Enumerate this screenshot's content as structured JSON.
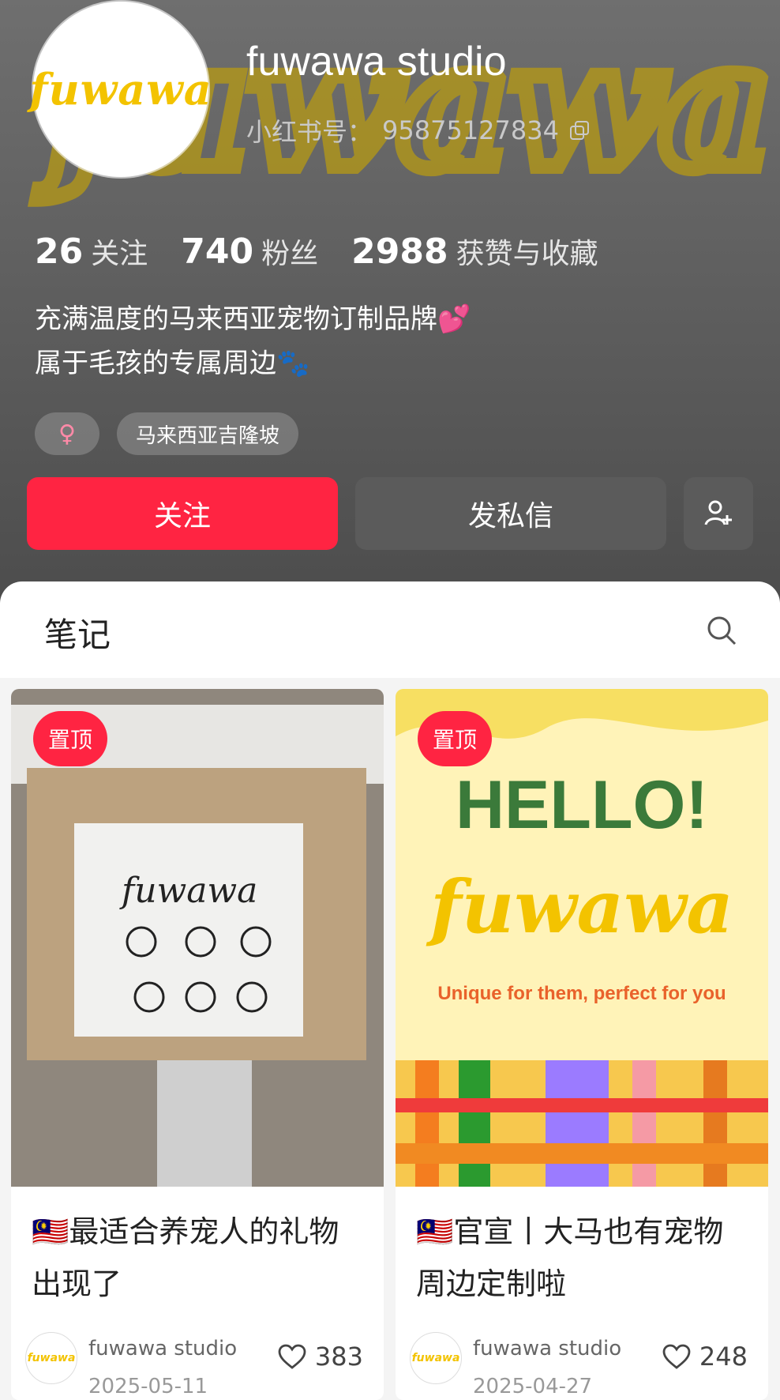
{
  "profile": {
    "name": "fuwawa studio",
    "redbook_label": "小红书号：",
    "redbook_id": "95875127834",
    "stats": [
      {
        "num": "26",
        "label": "关注"
      },
      {
        "num": "740",
        "label": "粉丝"
      },
      {
        "num": "2988",
        "label": "获赞与收藏"
      }
    ],
    "bio_line1": "充满温度的马来西亚宠物订制品牌💕",
    "bio_line2": "属于毛孩的专属周边🐾",
    "tags": {
      "gender": "♀",
      "location": "马来西亚吉隆坡"
    },
    "actions": {
      "follow": "关注",
      "message": "发私信"
    }
  },
  "notes": {
    "title": "笔记",
    "cards": [
      {
        "pin": "置顶",
        "title": "🇲🇾最适合养宠人的礼物出现了",
        "author": "fuwawa studio",
        "date": "2025-05-11",
        "likes": "383"
      },
      {
        "pin": "置顶",
        "title": "🇲🇾官宣丨大马也有宠物周边定制啦",
        "author": "fuwawa studio",
        "date": "2025-04-27",
        "likes": "248",
        "cover_text": {
          "hello": "HELLO!",
          "brand": "fuwawa",
          "tagline": "Unique for them, perfect for you"
        }
      }
    ]
  },
  "colors": {
    "accent": "#ff2442",
    "brand_yellow": "#f3c300",
    "header_bg": "#5a5a5a"
  }
}
